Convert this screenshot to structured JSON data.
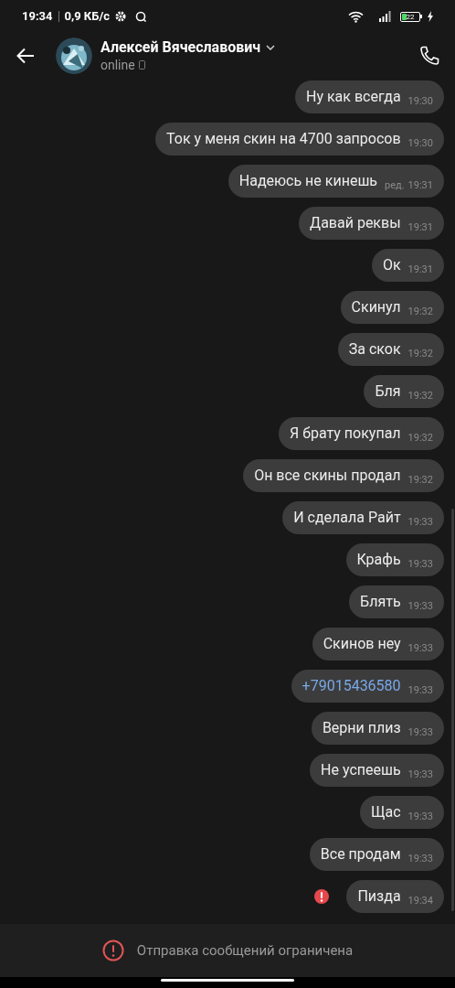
{
  "status_bar": {
    "time": "19:34",
    "speed": "0,9 КБ/с",
    "battery": "22"
  },
  "header": {
    "name": "Алексей Вячеславович",
    "status": "online"
  },
  "messages": [
    {
      "kind": "text",
      "text": "Ну как всегда",
      "time": "19:30"
    },
    {
      "kind": "text",
      "text": "Ток у меня скин на 4700 запросов",
      "time": "19:30"
    },
    {
      "kind": "text",
      "text": "Надеюсь не кинешь",
      "time": "19:31",
      "edited_label": "ред."
    },
    {
      "kind": "text",
      "text": "Давай реквы",
      "time": "19:31"
    },
    {
      "kind": "text",
      "text": "Ок",
      "time": "19:31"
    },
    {
      "kind": "text",
      "text": "Скинул",
      "time": "19:32"
    },
    {
      "kind": "text",
      "text": "За скок",
      "time": "19:32"
    },
    {
      "kind": "text",
      "text": "Бля",
      "time": "19:32"
    },
    {
      "kind": "text",
      "text": "Я брату покупал",
      "time": "19:32"
    },
    {
      "kind": "text",
      "text": "Он все скины продал",
      "time": "19:32"
    },
    {
      "kind": "text",
      "text": "И сделала Райт",
      "time": "19:33"
    },
    {
      "kind": "text",
      "text": "Крафь",
      "time": "19:33"
    },
    {
      "kind": "text",
      "text": "Блять",
      "time": "19:33"
    },
    {
      "kind": "text",
      "text": "Скинов неу",
      "time": "19:33"
    },
    {
      "kind": "link",
      "text": "+79015436580",
      "time": "19:33"
    },
    {
      "kind": "text",
      "text": "Верни плиз",
      "time": "19:33"
    },
    {
      "kind": "text",
      "text": "Не успеешь",
      "time": "19:33"
    },
    {
      "kind": "text",
      "text": "Щас",
      "time": "19:33"
    },
    {
      "kind": "text",
      "text": "Все продам",
      "time": "19:33"
    },
    {
      "kind": "text",
      "text": "Пизда",
      "time": "19:34",
      "failed": true
    }
  ],
  "restriction_notice": "Отправка сообщений ограничена"
}
